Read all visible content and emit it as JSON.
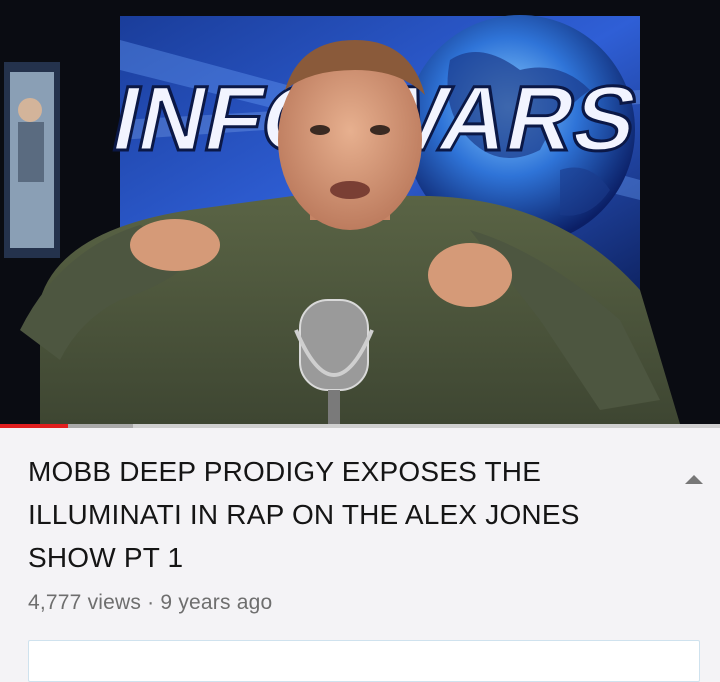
{
  "video": {
    "backdrop_logo_text": "INFO WARS",
    "progress_fraction": 0.094,
    "buffered_fraction": 0.185
  },
  "title": "MOBB DEEP PRODIGY EXPOSES THE ILLUMINATI IN RAP ON THE ALEX JONES SHOW PT 1",
  "stats": {
    "views": "4,777 views",
    "separator": "·",
    "age": "9 years ago"
  },
  "icons": {
    "expand": "chevron-up-icon"
  },
  "colors": {
    "progress": "#e11e1e",
    "page_bg": "#f4f3f6"
  }
}
